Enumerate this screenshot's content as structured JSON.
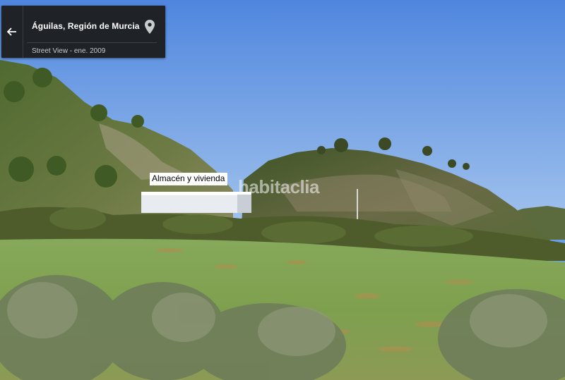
{
  "street_view_card": {
    "back_icon": "arrow-left-icon",
    "location_title": "Águilas, Región de Murcia",
    "pin_icon": "location-pin-icon",
    "date_text": "Street View - ene. 2009"
  },
  "overlay_label": "Almacén y vivienda",
  "watermark_text": "habitaclia",
  "colors": {
    "card_bg": "#1f2226",
    "sky_top": "#4f88e0",
    "sky_bottom": "#a9c8ee",
    "field": "#7fa352"
  }
}
